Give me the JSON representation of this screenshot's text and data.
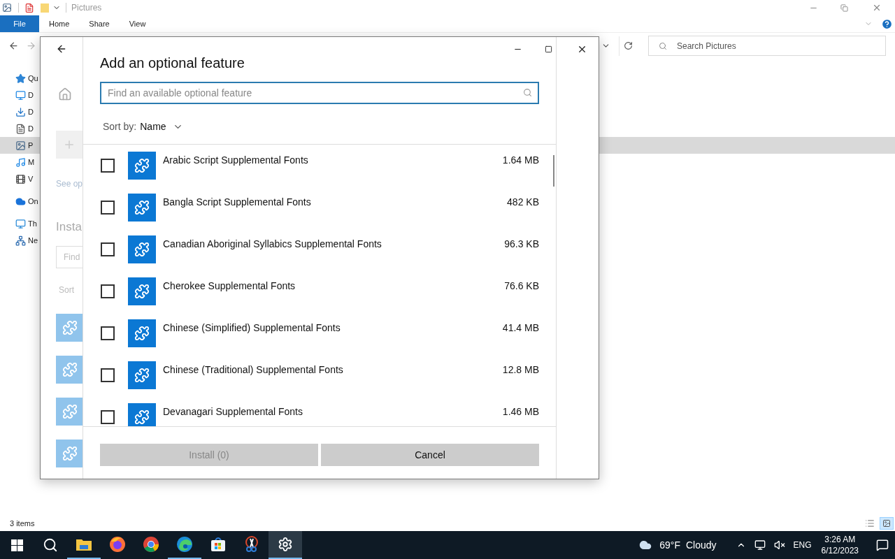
{
  "explorer": {
    "title": "Pictures",
    "ribbon_tabs": [
      {
        "label": "File",
        "kind": "file"
      },
      {
        "label": "Home",
        "kind": "tab"
      },
      {
        "label": "Share",
        "kind": "tab"
      },
      {
        "label": "View",
        "kind": "tab"
      }
    ],
    "search": {
      "placeholder": "Search Pictures"
    },
    "nav_items": [
      {
        "label": "Qu",
        "kind": "star",
        "selected": false
      },
      {
        "label": "D",
        "kind": "desktop",
        "selected": false
      },
      {
        "label": "D",
        "kind": "download",
        "selected": false
      },
      {
        "label": "D",
        "kind": "document",
        "selected": false
      },
      {
        "label": "P",
        "kind": "picture",
        "selected": true
      },
      {
        "label": "M",
        "kind": "music",
        "selected": false
      },
      {
        "label": "V",
        "kind": "video",
        "selected": false
      },
      {
        "label": "On",
        "kind": "cloud",
        "selected": false
      },
      {
        "label": "Th",
        "kind": "pc",
        "selected": false
      },
      {
        "label": "Ne",
        "kind": "network",
        "selected": false
      }
    ],
    "status": "3 items"
  },
  "settings_page": {
    "link": "See op",
    "heading": "Insta",
    "find_placeholder": "Find",
    "sort_label": "Sort"
  },
  "dialog": {
    "title": "Add an optional feature",
    "search": {
      "placeholder": "Find an available optional feature"
    },
    "sort_label": "Sort by:",
    "sort_value": "Name",
    "features": [
      {
        "name": "Arabic Script Supplemental Fonts",
        "size": "1.64 MB",
        "checked": false
      },
      {
        "name": "Bangla Script Supplemental Fonts",
        "size": "482 KB",
        "checked": false
      },
      {
        "name": "Canadian Aboriginal Syllabics Supplemental Fonts",
        "size": "96.3 KB",
        "checked": false
      },
      {
        "name": "Cherokee Supplemental Fonts",
        "size": "76.6 KB",
        "checked": false
      },
      {
        "name": "Chinese (Simplified) Supplemental Fonts",
        "size": "41.4 MB",
        "checked": false
      },
      {
        "name": "Chinese (Traditional) Supplemental Fonts",
        "size": "12.8 MB",
        "checked": false
      },
      {
        "name": "Devanagari Supplemental Fonts",
        "size": "1.46 MB",
        "checked": false
      }
    ],
    "buttons": [
      {
        "label": "Install (0)",
        "disabled": true
      },
      {
        "label": "Cancel",
        "disabled": false
      }
    ]
  },
  "taskbar": {
    "apps": [
      {
        "kind": "explorer",
        "running": true,
        "selected": false
      },
      {
        "kind": "firefox",
        "running": false,
        "selected": false
      },
      {
        "kind": "chrome",
        "running": false,
        "selected": false
      },
      {
        "kind": "edge",
        "running": true,
        "selected": false
      },
      {
        "kind": "store",
        "running": false,
        "selected": false
      },
      {
        "kind": "snip",
        "running": false,
        "selected": false
      },
      {
        "kind": "settings",
        "running": true,
        "selected": true
      }
    ],
    "weather": {
      "temperature": "69°F",
      "condition": "Cloudy"
    },
    "language": "ENG",
    "time": "3:26 AM",
    "date": "6/12/2023"
  }
}
